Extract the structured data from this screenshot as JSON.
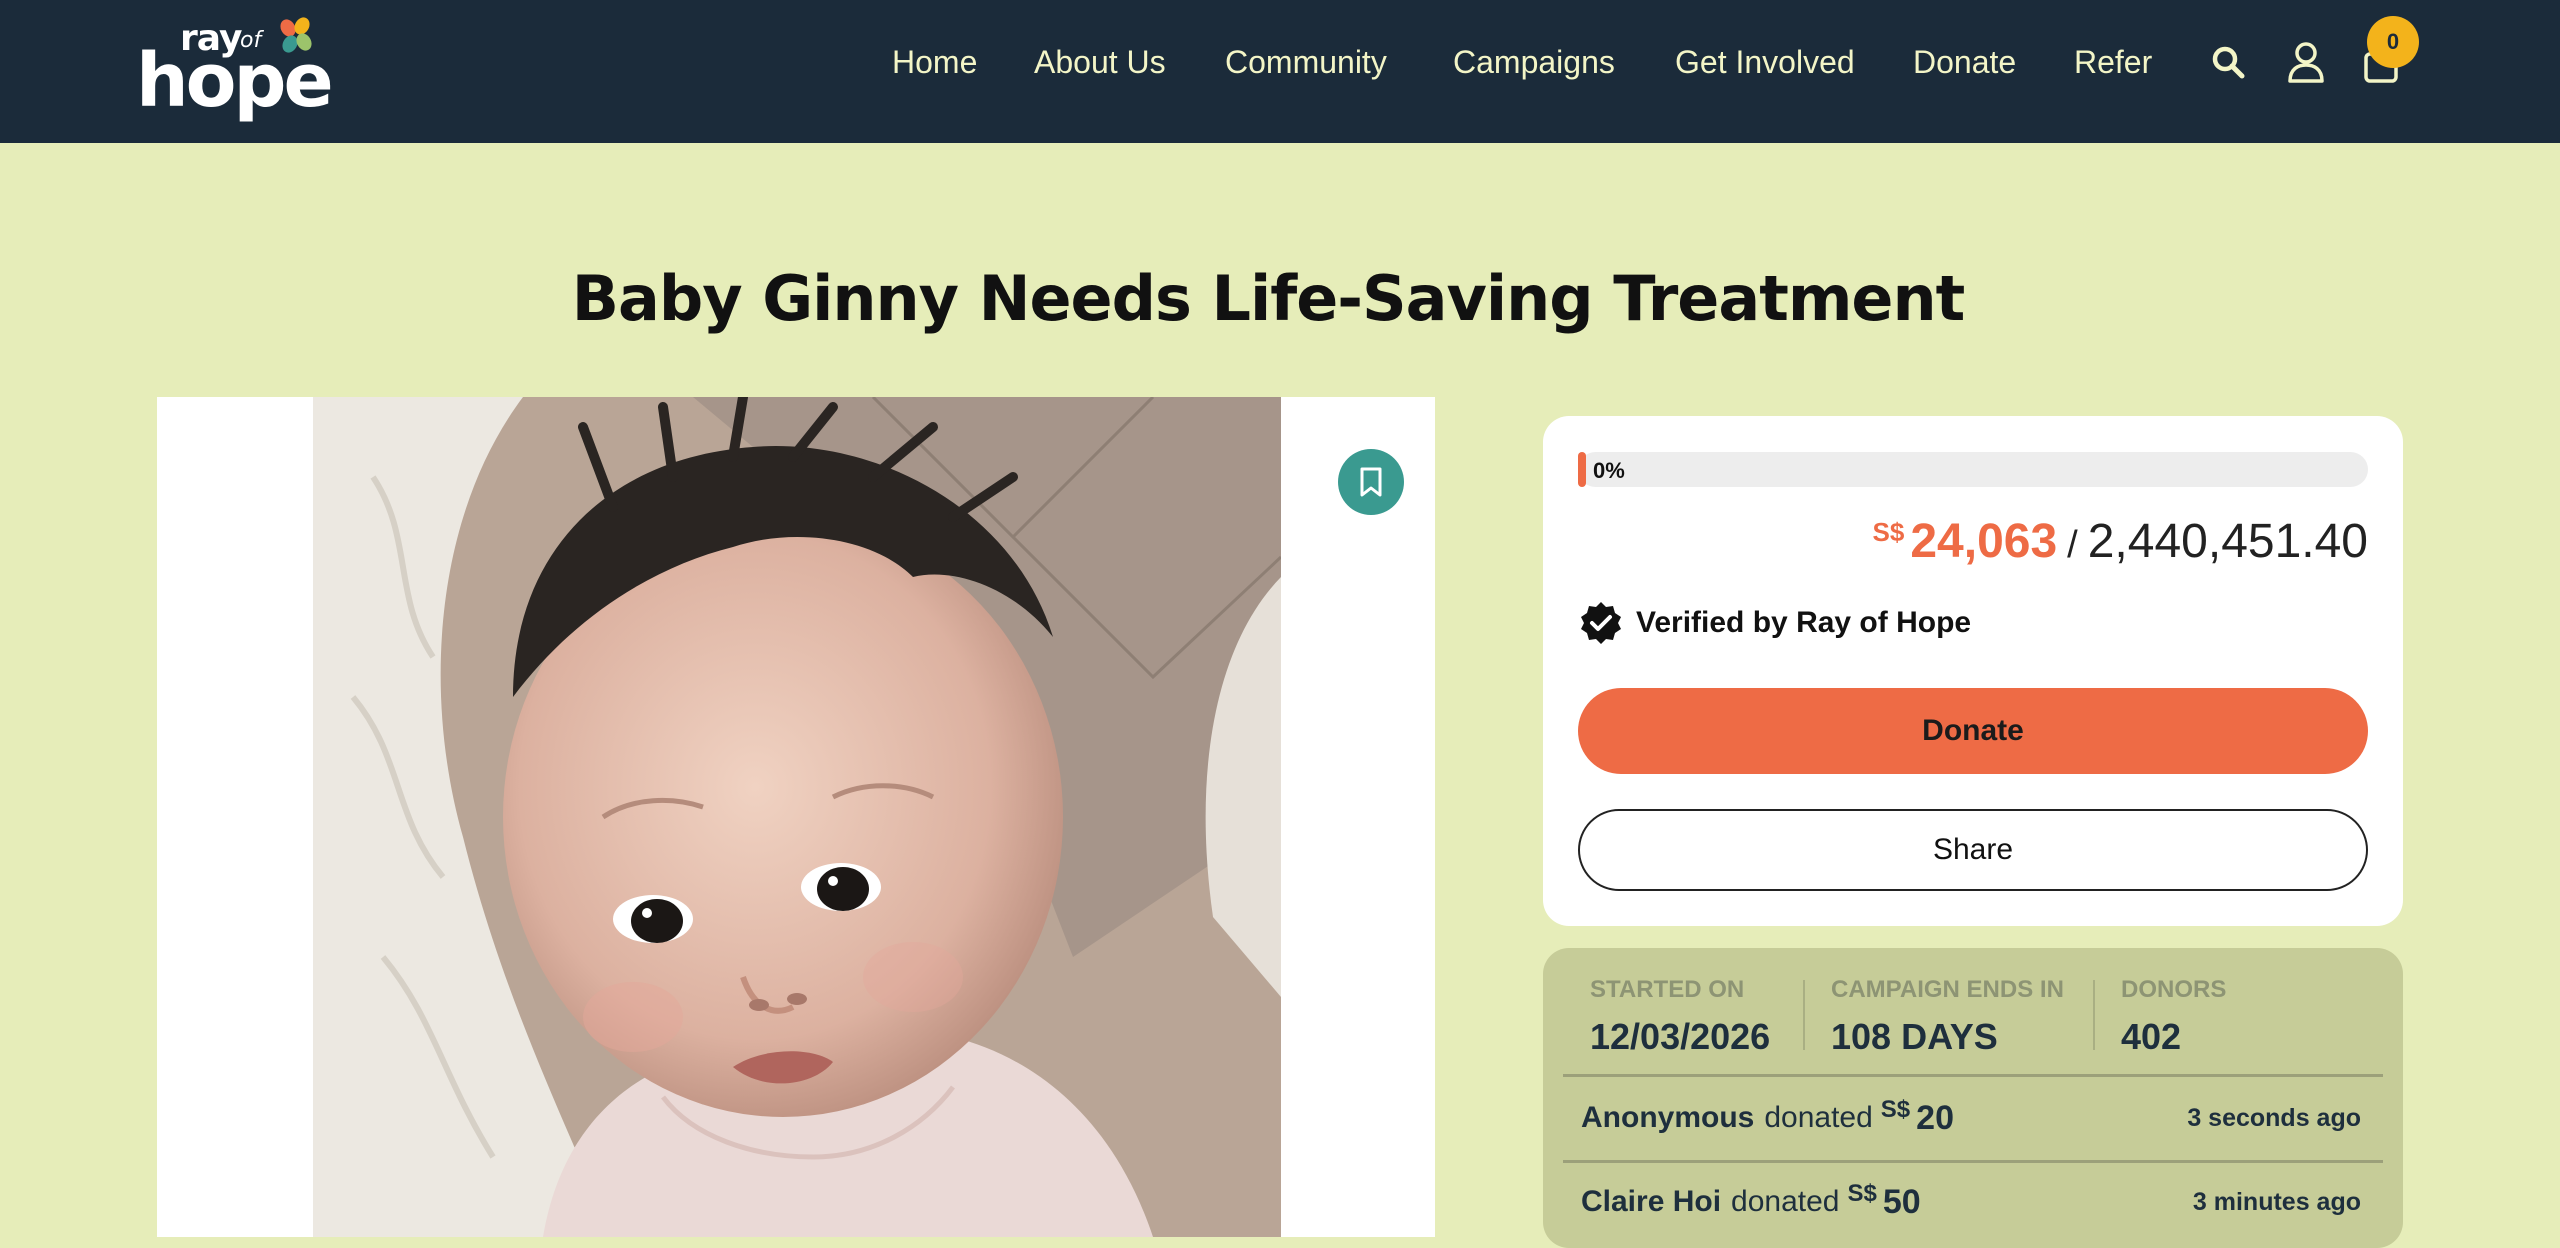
{
  "header": {
    "logo": {
      "ray": "ray",
      "of": "of",
      "hope": "hope"
    },
    "nav": [
      "Home",
      "About Us",
      "Community",
      "Campaigns",
      "Get Involved",
      "Donate",
      "Refer"
    ],
    "cart_count": "0",
    "icons": [
      "search-icon",
      "user-icon",
      "cart-icon"
    ],
    "colors": {
      "bg": "#1b2b3a",
      "nav_text": "#f3f5c7",
      "badge": "#f3b31b"
    }
  },
  "page": {
    "title": "Baby Ginny Needs Life-Saving Treatment",
    "background": "#e6edb9"
  },
  "media": {
    "bookmark_icon": "bookmark-icon"
  },
  "campaign": {
    "progress_label": "0%",
    "progress_fraction": 0.01,
    "currency": "S$",
    "raised": "24,063",
    "separator": "/",
    "goal": "2,440,451.40",
    "verified_label": "Verified by Ray of Hope",
    "donate_label": "Donate",
    "share_label": "Share",
    "accent": "#ee6b45"
  },
  "stats": {
    "started_label": "STARTED ON",
    "started_value": "12/03/2026",
    "ends_label": "CAMPAIGN ENDS IN",
    "ends_value": "108 DAYS",
    "donors_label": "DONORS",
    "donors_value": "402"
  },
  "donations": [
    {
      "name": "Anonymous",
      "verb": "donated",
      "currency": "S$",
      "amount": "20",
      "time": "3 seconds ago"
    },
    {
      "name": "Claire Hoi",
      "verb": "donated",
      "currency": "S$",
      "amount": "50",
      "time": "3 minutes ago"
    }
  ]
}
